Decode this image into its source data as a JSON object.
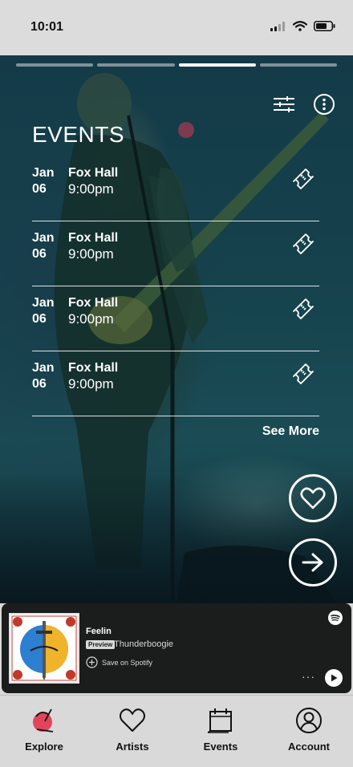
{
  "status_bar": {
    "time": "10:01",
    "icons": [
      "cellular-signal-icon",
      "wifi-icon",
      "battery-icon"
    ]
  },
  "story": {
    "segments": 4,
    "active_segment": 3
  },
  "actions": {
    "icons": [
      "filter-sliders-icon",
      "more-options-icon"
    ]
  },
  "events": {
    "title": "EVENTS",
    "items": [
      {
        "month": "Jan",
        "day": "06",
        "venue": "Fox Hall",
        "time": "9:00pm",
        "icon": "ticket-icon"
      },
      {
        "month": "Jan",
        "day": "06",
        "venue": "Fox Hall",
        "time": "9:00pm",
        "icon": "ticket-icon"
      },
      {
        "month": "Jan",
        "day": "06",
        "venue": "Fox Hall",
        "time": "9:00pm",
        "icon": "ticket-icon"
      },
      {
        "month": "Jan",
        "day": "06",
        "venue": "Fox Hall",
        "time": "9:00pm",
        "icon": "ticket-icon"
      }
    ],
    "see_more": "See More"
  },
  "floating_buttons": {
    "like_icon": "heart-icon",
    "next_icon": "arrow-right-icon"
  },
  "player": {
    "track": "Feelin",
    "badge": "Preview",
    "artist": "Thunderboogie",
    "save_label": "Save on Spotify",
    "more": "···",
    "icons": [
      "spotify-logo-icon",
      "add-circle-icon",
      "play-icon"
    ]
  },
  "tabs": [
    {
      "label": "Explore",
      "icon": "explore-icon",
      "accent": "#e2445c"
    },
    {
      "label": "Artists",
      "icon": "heart-outline-icon"
    },
    {
      "label": "Events",
      "icon": "calendar-icon"
    },
    {
      "label": "Account",
      "icon": "user-circle-icon"
    }
  ],
  "colors": {
    "background_tint": "#164452",
    "explore_accent": "#e2445c",
    "album_blue": "#2d7fd2",
    "album_yellow": "#f0b42a"
  }
}
